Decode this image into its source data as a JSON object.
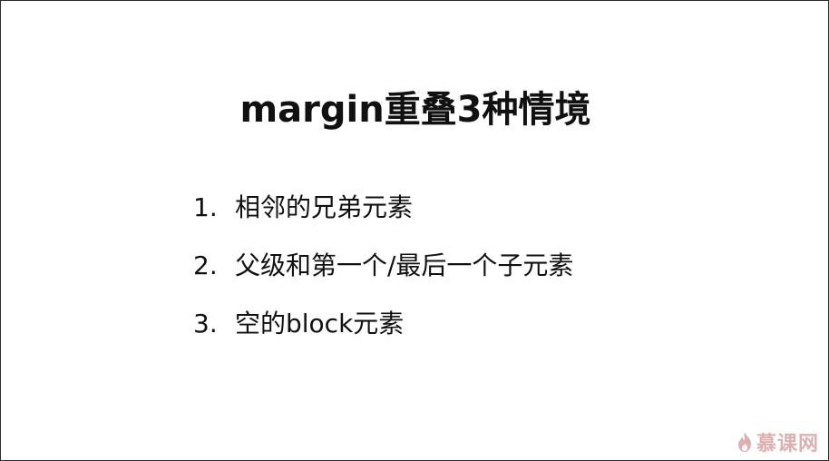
{
  "slide": {
    "title": "margin重叠3种情境",
    "items": [
      {
        "num": "1.",
        "text": "相邻的兄弟元素"
      },
      {
        "num": "2.",
        "text": "父级和第一个/最后一个子元素"
      },
      {
        "num": "3.",
        "text": "空的block元素"
      }
    ]
  },
  "watermark": {
    "text": "慕课网",
    "icon": "flame-logo-icon",
    "color": "#c07070"
  }
}
